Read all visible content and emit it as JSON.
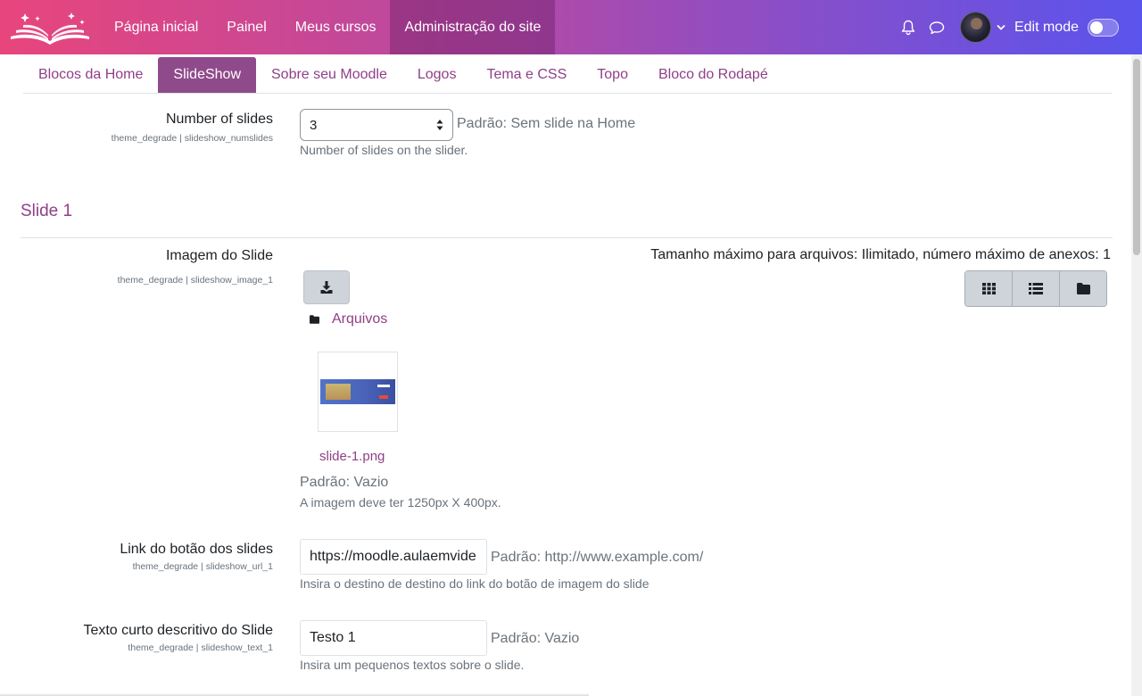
{
  "navbar": {
    "logo_icon": "open-book-icon",
    "links": [
      {
        "label": "Página inicial"
      },
      {
        "label": "Painel"
      },
      {
        "label": "Meus cursos"
      },
      {
        "label": "Administração do site",
        "active": true
      }
    ],
    "notification_icon": "bell-icon",
    "messages_icon": "chat-icon",
    "edit_mode_label": "Edit mode",
    "edit_mode_on": false
  },
  "tabs": [
    {
      "label": "Blocos da Home"
    },
    {
      "label": "SlideShow",
      "active": true
    },
    {
      "label": "Sobre seu Moodle"
    },
    {
      "label": "Logos"
    },
    {
      "label": "Tema e CSS"
    },
    {
      "label": "Topo"
    },
    {
      "label": "Bloco do Rodapé"
    }
  ],
  "settings": {
    "numslides": {
      "title": "Number of slides",
      "key": "theme_degrade | slideshow_numslides",
      "value": "3",
      "default": "Padrão: Sem slide na Home",
      "description": "Number of slides on the slider."
    },
    "section_heading": "Slide 1",
    "image": {
      "title": "Imagem do Slide",
      "key": "theme_degrade | slideshow_image_1",
      "limits": "Tamanho máximo para arquivos: Ilimitado, número máximo de anexos: 1",
      "folder_label": "Arquivos",
      "file_name": "slide-1.png",
      "default": "Padrão: Vazio",
      "description": "A imagem deve ter 1250px X 400px."
    },
    "url": {
      "title": "Link do botão dos slides",
      "key": "theme_degrade | slideshow_url_1",
      "value": "https://moodle.aulaemvide",
      "default": "Padrão: http://www.example.com/",
      "description": "Insira o destino de destino do link do botão de imagem do slide"
    },
    "text": {
      "title": "Texto curto descritivo do Slide",
      "key": "theme_degrade | slideshow_text_1",
      "value": "Testo 1",
      "default": "Padrão: Vazio",
      "description": "Insira um pequenos textos sobre o slide."
    }
  },
  "colors": {
    "accent": "#8f3f87",
    "active_tab": "#8f4a8c",
    "navbar_start": "#e8457c",
    "navbar_end": "#5b54ec"
  }
}
